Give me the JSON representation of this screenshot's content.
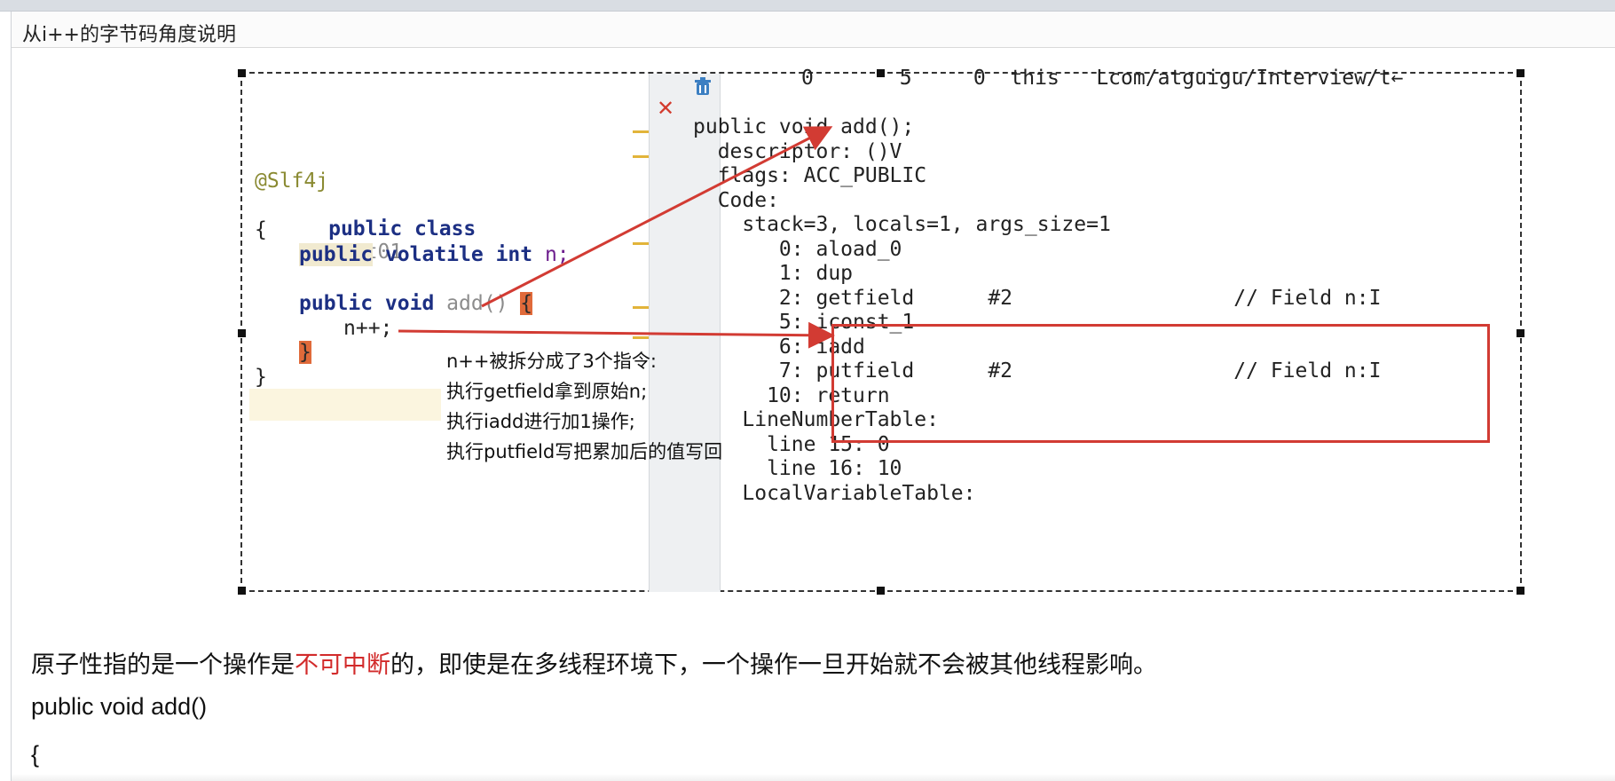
{
  "doc": {
    "title": "从i++的字节码角度说明"
  },
  "figure": {
    "code": {
      "annotation": "@Slf4j",
      "class_kw": "public class",
      "class_name": "Test01",
      "open_brace": "{",
      "field_public": "public",
      "field_rest_kw": " volatile int",
      "field_name": " n;",
      "method_kw": "public void",
      "method_name": " add()",
      "method_brace": "{",
      "stmt": "n++;",
      "close_method": "}",
      "close_class": "}"
    },
    "bytecode": {
      "header": "0       5     0  this   Lcom/atguigu/Interview/t←",
      "method_sig": "public void add();",
      "descriptor": "  descriptor: ()V",
      "flags": "  flags: ACC_PUBLIC",
      "code": "  Code:",
      "stack": "    stack=3, locals=1, args_size=1",
      "i0": "       0: aload_0",
      "i1": "       1: dup",
      "i2": "       2: getfield      #2                  // Field n:I",
      "i5": "       5: iconst_1",
      "i6": "       6: iadd",
      "i7": "       7: putfield      #2                  // Field n:I",
      "i10": "      10: return",
      "lnt": "    LineNumberTable:",
      "line15": "      line 15: 0",
      "line16": "      line 16: 10",
      "lvt": "    LocalVariableTable:"
    },
    "notes": [
      "n++被拆分成了3个指令:",
      "执行getfield拿到原始n;",
      "执行iadd进行加1操作;",
      "执行putfield写把累加后的值写回"
    ],
    "colors": {
      "arrow": "#d23b33",
      "box": "#d23b33"
    }
  },
  "body": {
    "para_prefix": "原子性指的是一个操作是",
    "para_red": "不可中断",
    "para_suffix": "的，即使是在多线程环境下，一个操作一旦开始就不会被其他线程影响。",
    "line1": "public void add()",
    "line2": "{"
  }
}
